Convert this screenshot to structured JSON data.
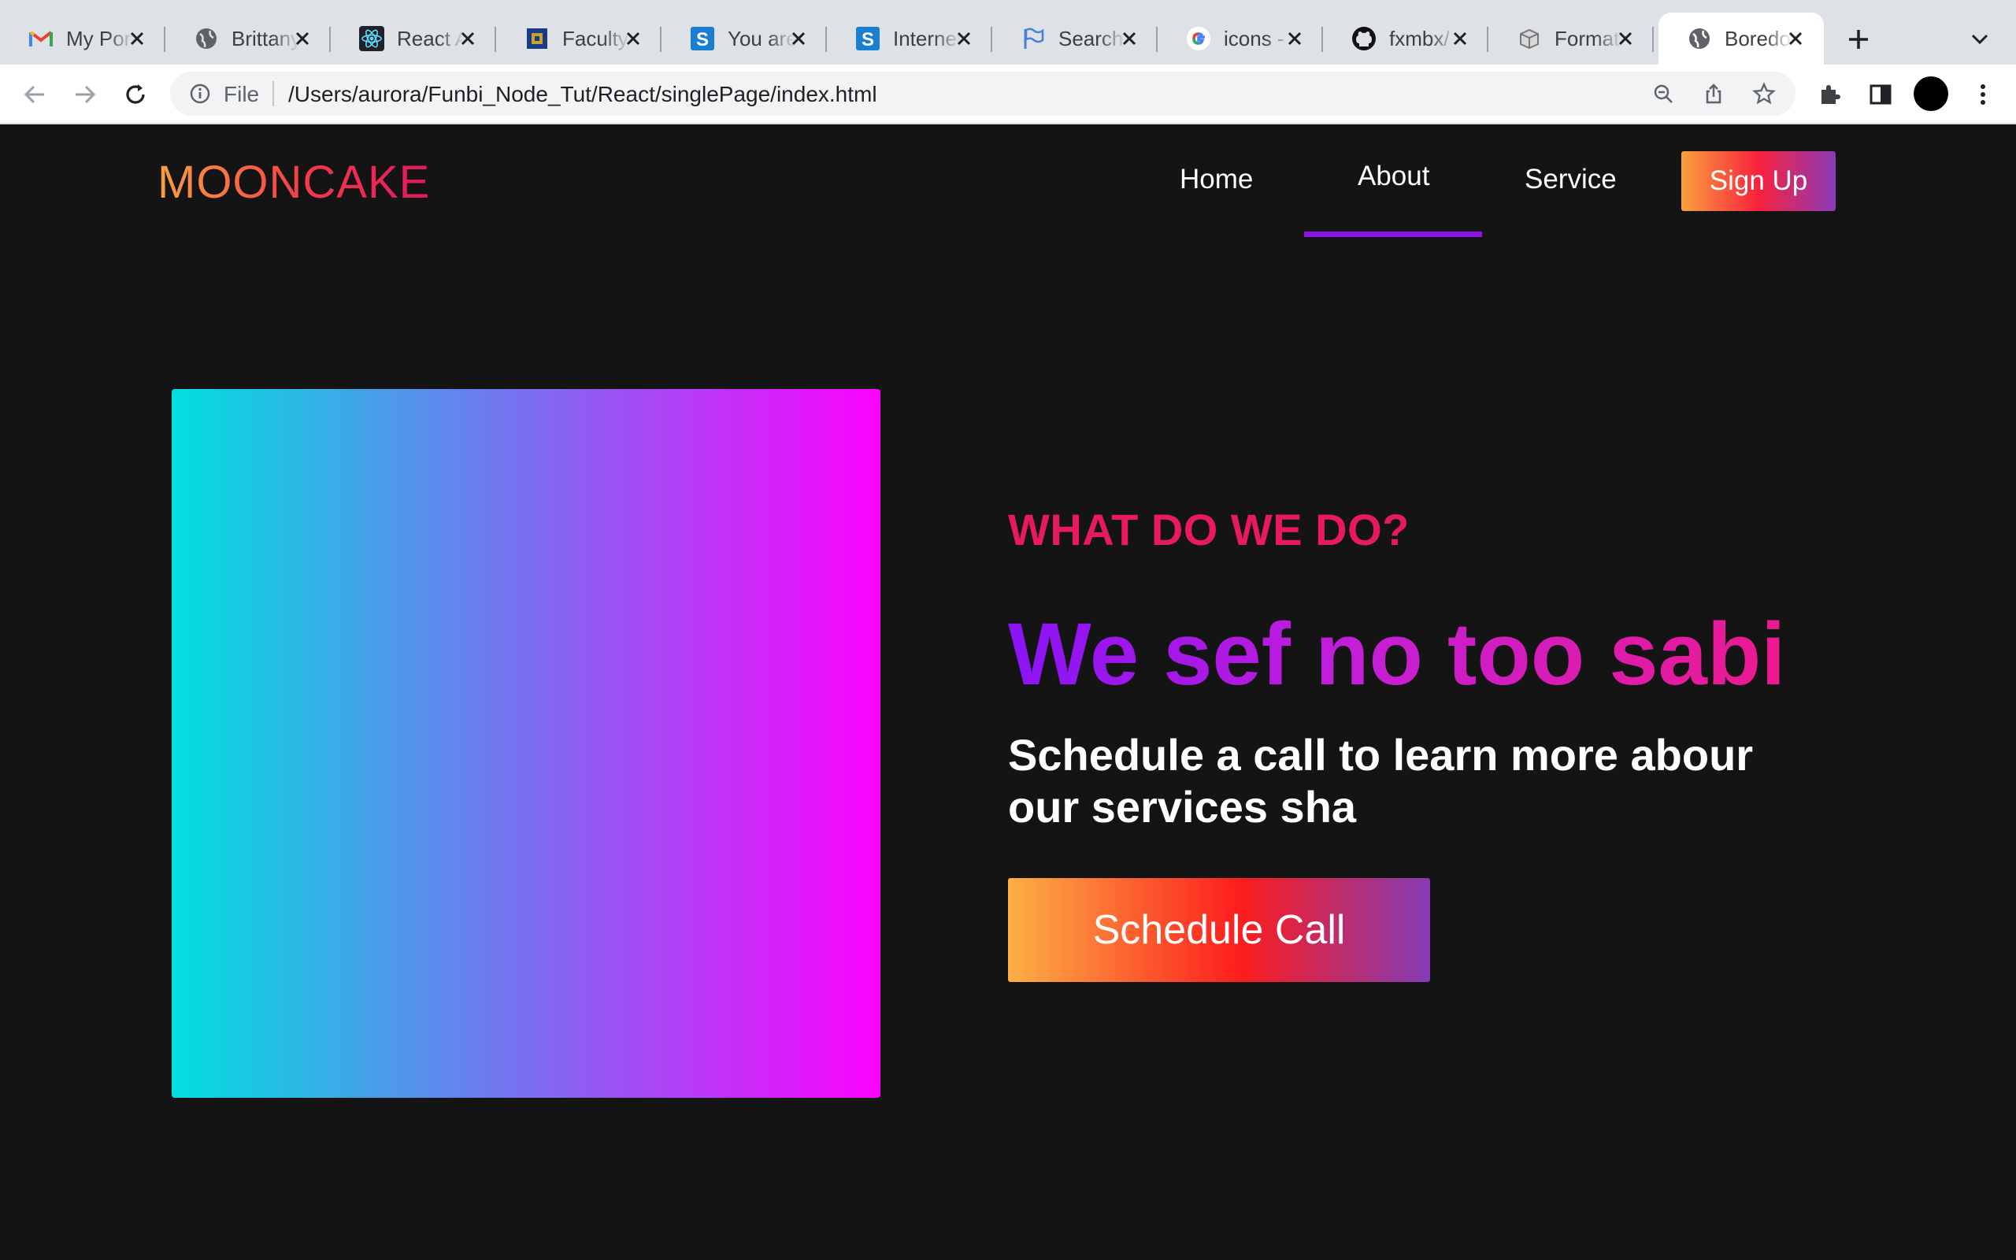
{
  "browser": {
    "tabs": [
      {
        "title": "My Portfolio",
        "icon": "gmail-icon"
      },
      {
        "title": "Brittany Chiang",
        "icon": "globe-icon"
      },
      {
        "title": "React App",
        "icon": "react-icon"
      },
      {
        "title": "Faculty",
        "icon": "faculty-icon"
      },
      {
        "title": "You are",
        "icon": "s-logo-icon"
      },
      {
        "title": "Internet",
        "icon": "s-logo-icon"
      },
      {
        "title": "Search",
        "icon": "flag-icon"
      },
      {
        "title": "icons -",
        "icon": "google-icon"
      },
      {
        "title": "fxmbx/",
        "icon": "github-icon"
      },
      {
        "title": "Format",
        "icon": "box-icon"
      },
      {
        "title": "Boredom",
        "icon": "globe-icon",
        "active": true
      }
    ],
    "address": {
      "scheme_label": "File",
      "url": "/Users/aurora/Funbi_Node_Tut/React/singlePage/index.html"
    }
  },
  "site": {
    "logo": "MOONCAKE",
    "nav": {
      "home": "Home",
      "about": "About",
      "service": "Service",
      "signup": "Sign Up",
      "active": "About"
    },
    "hero": {
      "kicker": "WHAT DO WE DO?",
      "headline": "We sef no too sabi",
      "subtext": "Schedule a call to learn more abour our services sha",
      "cta": "Schedule Call"
    }
  },
  "colors": {
    "page_bg": "#141414",
    "accent_purple": "#8a13e6",
    "kicker_pink": "#e81a5f",
    "box_gradient": [
      "#00e0de",
      "#fc02fd"
    ]
  }
}
